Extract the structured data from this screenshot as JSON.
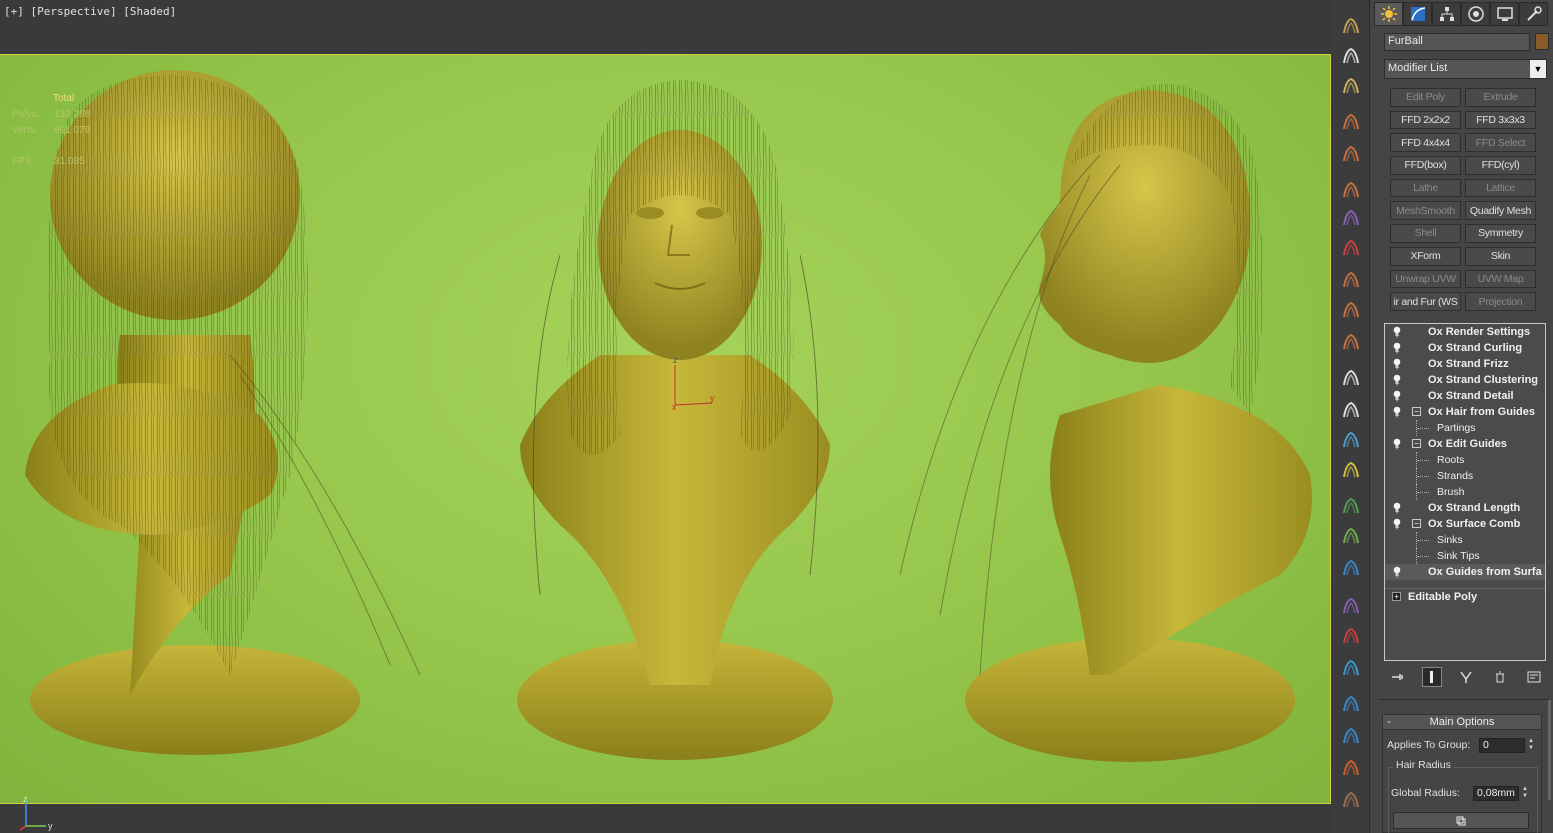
{
  "viewport": {
    "label_plus": "[+]",
    "label_view": "[Perspective]",
    "label_mode": "[Shaded]",
    "stats": {
      "title": "Total",
      "polys_label": "Polys:",
      "polys_value": "132 288",
      "verts_label": "Verts:",
      "verts_value": "691 079",
      "fps_label": "FPS:",
      "fps_value": "31.085"
    },
    "gizmo_axes": {
      "z": "z",
      "x": "x",
      "y": "y"
    },
    "tripod": {
      "z": "z",
      "y": "y"
    },
    "background_color": "#94c54a",
    "model_color": "#b5a832",
    "border_color": "#d2d23c"
  },
  "command_panel": {
    "tabs": [
      {
        "icon": "create-icon",
        "active": true
      },
      {
        "icon": "modify-icon",
        "active": false
      },
      {
        "icon": "hierarchy-icon",
        "active": false
      },
      {
        "icon": "motion-icon",
        "active": false
      },
      {
        "icon": "display-icon",
        "active": false
      },
      {
        "icon": "utilities-icon",
        "active": false
      }
    ],
    "object_name": "FurBall",
    "object_color": "#8b5a2b",
    "modifier_list": "Modifier List",
    "modifier_buttons": [
      {
        "label": "Edit Poly",
        "dim": true
      },
      {
        "label": "Extrude",
        "dim": true
      },
      {
        "label": "FFD 2x2x2",
        "dim": false
      },
      {
        "label": "FFD 3x3x3",
        "dim": false
      },
      {
        "label": "FFD 4x4x4",
        "dim": false
      },
      {
        "label": "FFD Select",
        "dim": true
      },
      {
        "label": "FFD(box)",
        "dim": false
      },
      {
        "label": "FFD(cyl)",
        "dim": false
      },
      {
        "label": "Lathe",
        "dim": true
      },
      {
        "label": "Lattice",
        "dim": true
      },
      {
        "label": "MeshSmooth",
        "dim": true
      },
      {
        "label": "Quadify Mesh",
        "dim": false
      },
      {
        "label": "Shell",
        "dim": true
      },
      {
        "label": "Symmetry",
        "dim": false
      },
      {
        "label": "XForm",
        "dim": false
      },
      {
        "label": "Skin",
        "dim": false
      },
      {
        "label": "Unwrap UVW",
        "dim": true
      },
      {
        "label": "UVW Map",
        "dim": true
      },
      {
        "label": "ir and Fur (WS",
        "dim": false
      },
      {
        "label": "Projection",
        "dim": true
      }
    ],
    "stack": [
      {
        "label": "Ox Render Settings",
        "type": "mod"
      },
      {
        "label": "Ox Strand Curling",
        "type": "mod"
      },
      {
        "label": "Ox Strand Frizz",
        "type": "mod"
      },
      {
        "label": "Ox Strand Clustering",
        "type": "mod"
      },
      {
        "label": "Ox Strand Detail",
        "type": "mod"
      },
      {
        "label": "Ox Hair from Guides",
        "type": "mod-exp"
      },
      {
        "label": "Partings",
        "type": "sub"
      },
      {
        "label": "Ox Edit Guides",
        "type": "mod-exp"
      },
      {
        "label": "Roots",
        "type": "sub"
      },
      {
        "label": "Strands",
        "type": "sub"
      },
      {
        "label": "Brush",
        "type": "sub"
      },
      {
        "label": "Ox Strand Length",
        "type": "mod"
      },
      {
        "label": "Ox Surface Comb",
        "type": "mod-exp"
      },
      {
        "label": "Sinks",
        "type": "sub"
      },
      {
        "label": "Sink Tips",
        "type": "sub"
      },
      {
        "label": "Ox Guides from Surfa",
        "type": "mod-sel"
      }
    ],
    "base_object": "Editable Poly",
    "stack_tools": [
      {
        "icon": "pin-stack-icon"
      },
      {
        "icon": "show-end-result-icon"
      },
      {
        "icon": "make-unique-icon"
      },
      {
        "icon": "remove-modifier-icon"
      },
      {
        "icon": "configure-modifier-sets-icon"
      }
    ],
    "rollout": {
      "title": "Main Options",
      "collapse": "-",
      "applies_label": "Applies To Group:",
      "applies_value": "0",
      "group_title": "Hair Radius",
      "global_radius_label": "Global Radius:",
      "global_radius_value": "0,08mm"
    }
  },
  "side_icons": [
    "ox-render-icon",
    "ox-list-icon",
    "ox-camera-icon",
    "ox-curl-icon",
    "ox-frizz-icon",
    "ox-cluster-icon",
    "ox-detail-icon",
    "ox-guides-icon",
    "ox-length-icon",
    "ox-comb-icon",
    "ox-surface-icon",
    "ox-twist-icon",
    "ox-select-icon",
    "ox-edit-icon",
    "ox-braid-icon",
    "ox-grass-icon",
    "ox-mesh-icon",
    "ox-blue-icon",
    "ox-sphere-icon",
    "ox-red-icon",
    "ox-teal-icon",
    "ox-water-icon",
    "ox-chain-icon",
    "ox-wave-icon",
    "ox-brown-icon"
  ]
}
